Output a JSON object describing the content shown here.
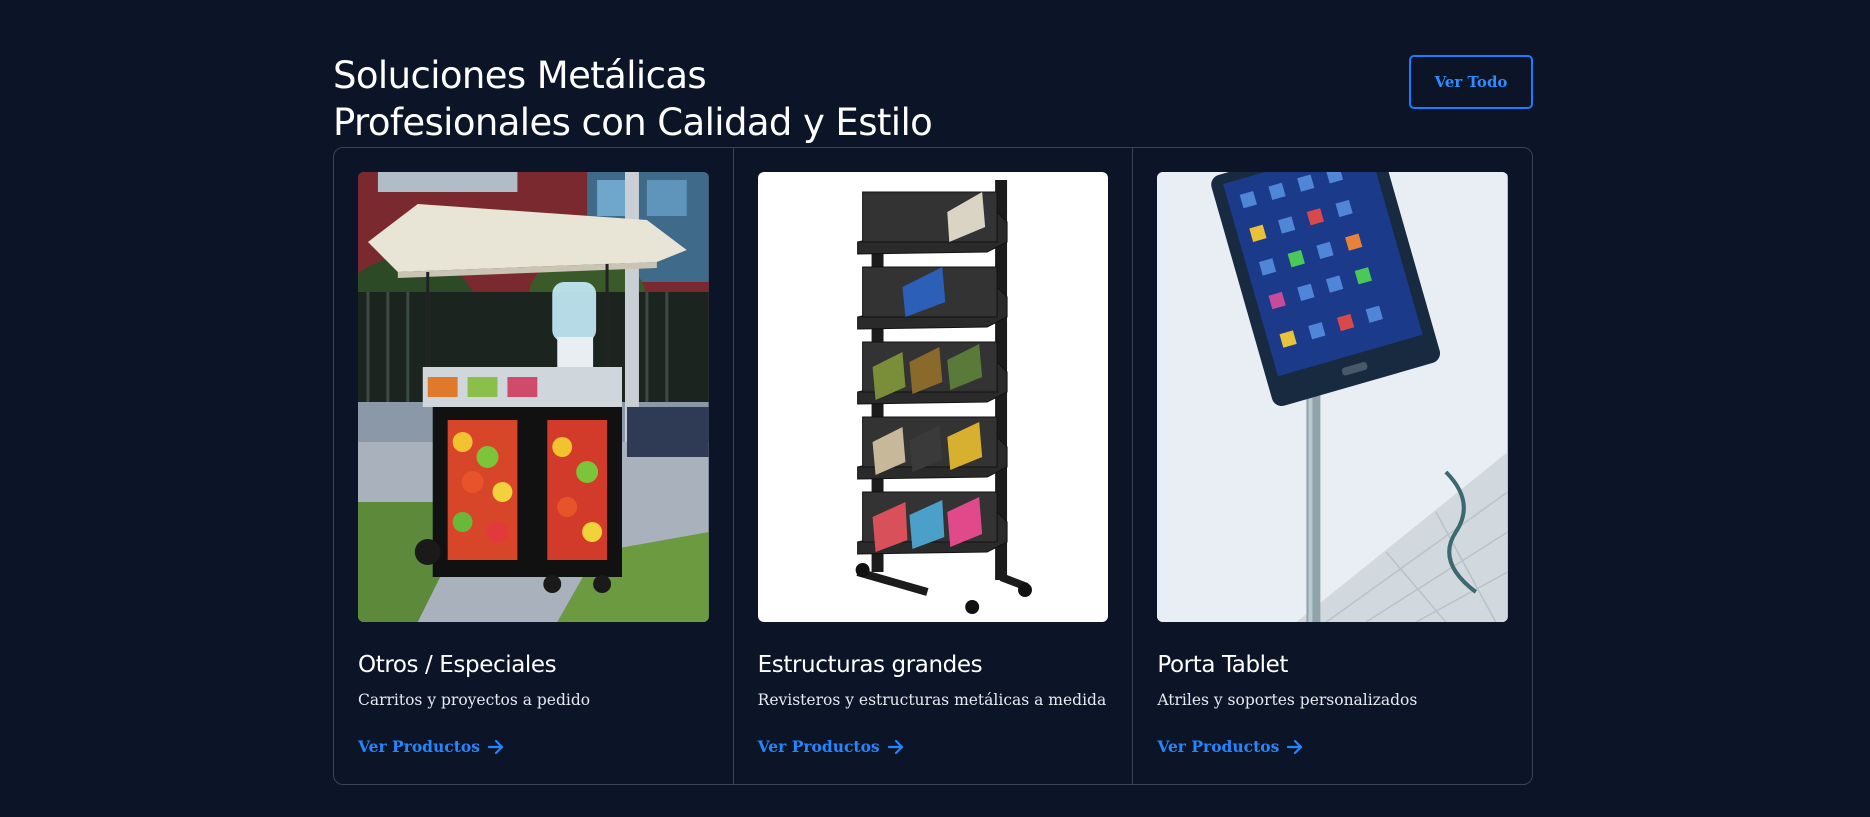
{
  "section": {
    "heading_line1": "Soluciones Metálicas",
    "heading_line2": "Profesionales con Calidad y Estilo",
    "view_all_label": "Ver Todo"
  },
  "cards": [
    {
      "image": "food-cart-photo",
      "title": "Otros / Especiales",
      "description": "Carritos y proyectos a pedido",
      "link_label": "Ver Productos",
      "link_icon": "arrow-right-icon"
    },
    {
      "image": "magazine-rack-photo",
      "title": "Estructuras grandes",
      "description": "Revisteros y estructuras metálicas a medida",
      "link_label": "Ver Productos",
      "link_icon": "arrow-right-icon"
    },
    {
      "image": "tablet-stand-photo",
      "title": "Porta Tablet",
      "description": "Atriles y soportes personalizados",
      "link_label": "Ver Productos",
      "link_icon": "arrow-right-icon"
    }
  ],
  "colors": {
    "background": "#0c1528",
    "accent": "#2486ff",
    "border": "#3a4353",
    "text": "#ffffff"
  }
}
